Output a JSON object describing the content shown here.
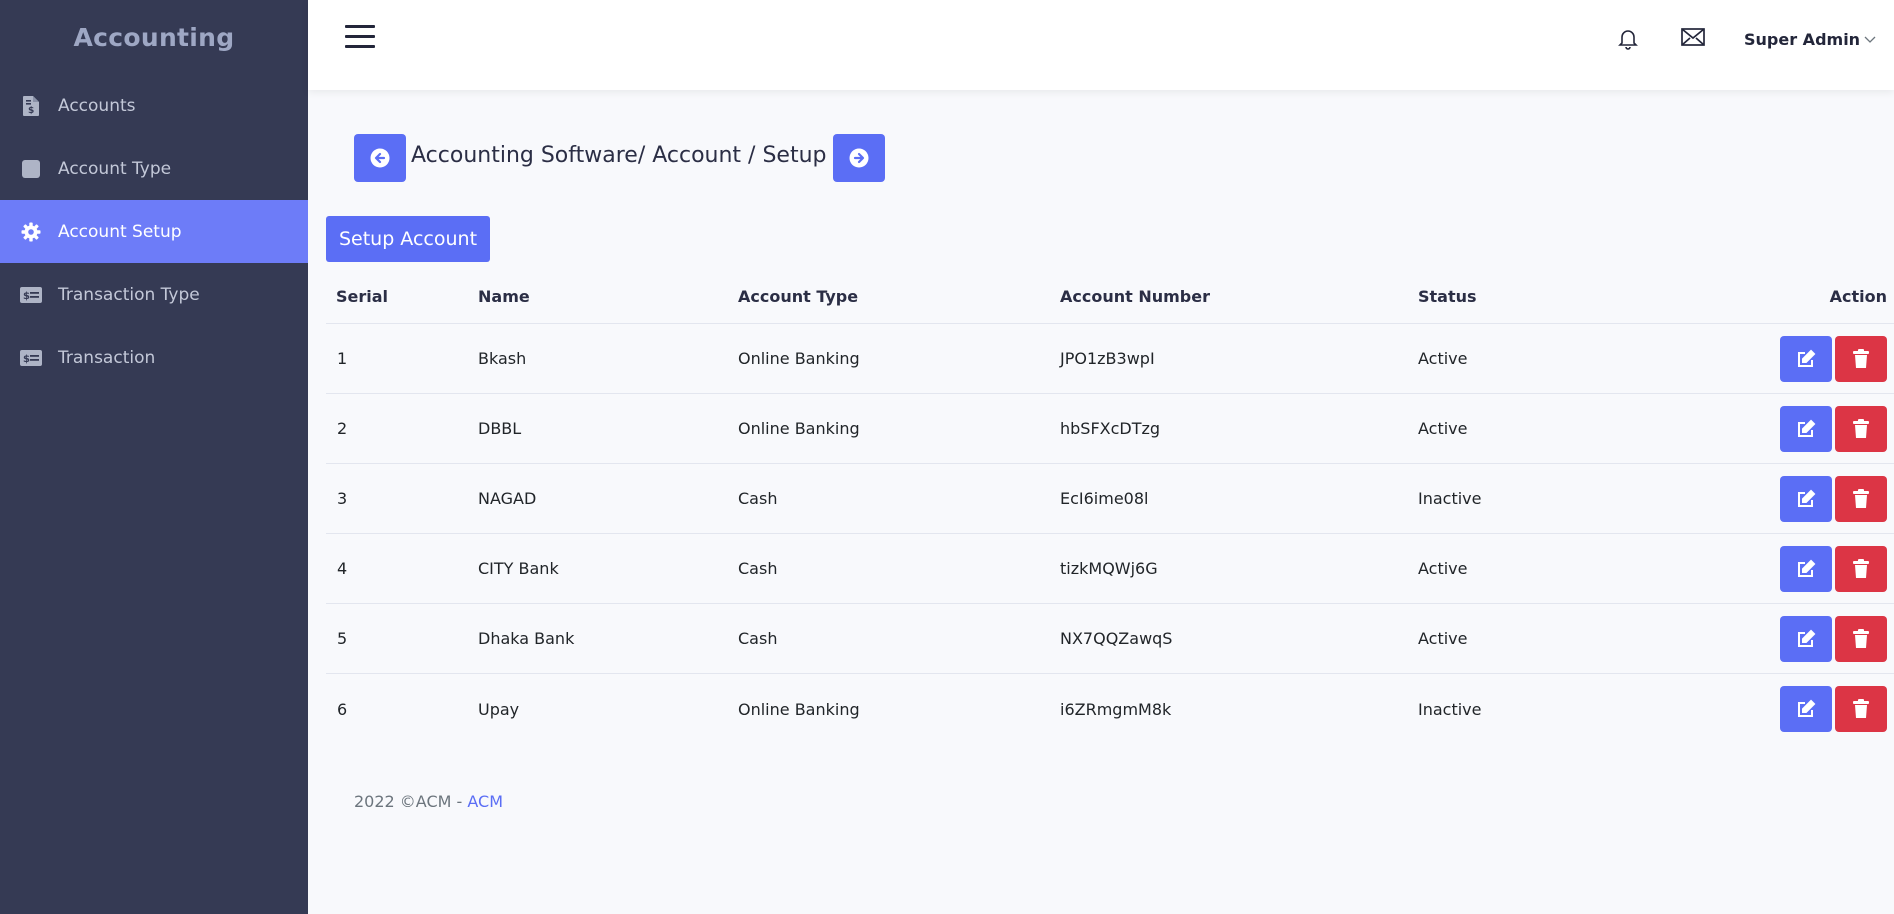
{
  "sidebar": {
    "brand": "Accounting",
    "items": [
      {
        "label": "Accounts",
        "icon": "file-invoice-dollar-icon"
      },
      {
        "label": "Account Type",
        "icon": "square-icon"
      },
      {
        "label": "Account Setup",
        "icon": "gear-icon",
        "active": true
      },
      {
        "label": "Transaction Type",
        "icon": "money-check-icon"
      },
      {
        "label": "Transaction",
        "icon": "money-check-icon"
      }
    ]
  },
  "topbar": {
    "user": "Super Admin"
  },
  "breadcrumb": {
    "title": "Accounting Software/ Account / Setup"
  },
  "setup_button": "Setup Account",
  "table": {
    "headers": [
      "Serial",
      "Name",
      "Account Type",
      "Account Number",
      "Status",
      "Action"
    ],
    "rows": [
      {
        "serial": "1",
        "name": "Bkash",
        "type": "Online Banking",
        "number": "JPO1zB3wpI",
        "status": "Active"
      },
      {
        "serial": "2",
        "name": "DBBL",
        "type": "Online Banking",
        "number": "hbSFXcDTzg",
        "status": "Active"
      },
      {
        "serial": "3",
        "name": "NAGAD",
        "type": "Cash",
        "number": "EcI6ime08l",
        "status": "Inactive"
      },
      {
        "serial": "4",
        "name": "CITY Bank",
        "type": "Cash",
        "number": "tizkMQWj6G",
        "status": "Active"
      },
      {
        "serial": "5",
        "name": "Dhaka Bank",
        "type": "Cash",
        "number": "NX7QQZawqS",
        "status": "Active"
      },
      {
        "serial": "6",
        "name": "Upay",
        "type": "Online Banking",
        "number": "i6ZRmgmM8k",
        "status": "Inactive"
      }
    ]
  },
  "footer": {
    "text": "2022 ©ACM - ",
    "link": "ACM"
  },
  "colors": {
    "sidebar_bg": "#353a54",
    "accent": "#5b6ef5",
    "active_item": "#6d7cf8",
    "danger": "#dc3545"
  }
}
